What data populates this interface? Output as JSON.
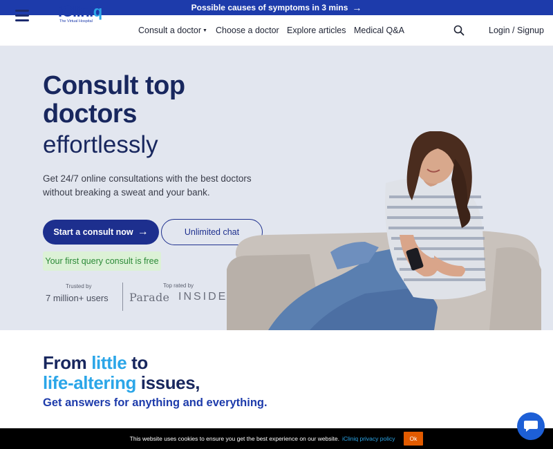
{
  "banner": {
    "text": "Possible causes of symptoms in 3 mins",
    "arrow": "→"
  },
  "nav": {
    "logo_text": "iClini",
    "logo_q": "q",
    "logo_tagline": "The Virtual Hospital",
    "items": [
      {
        "label": "Consult a doctor",
        "has_dropdown": true
      },
      {
        "label": "Choose a doctor"
      },
      {
        "label": "Explore articles"
      },
      {
        "label": "Medical Q&A"
      }
    ],
    "login": "Login / Signup"
  },
  "hero": {
    "title_line1": "Consult top",
    "title_line2": "doctors",
    "title_line3": "effortlessly",
    "subtitle": "Get 24/7 online consultations with the best doctors without breaking a sweat and your bank.",
    "primary_button": "Start a consult now",
    "primary_arrow": "→",
    "secondary_button": "Unlimited chat",
    "free_note": "Your first query consult is free",
    "trusted_label": "Trusted by",
    "trusted_value": "7 million+ users",
    "toprated_label": "Top rated by",
    "press": [
      "Parade",
      "INSIDER"
    ]
  },
  "section2": {
    "line1_a": "From ",
    "line1_hl": "little",
    "line1_b": " to",
    "line2_hl": "life-altering",
    "line2_b": " issues,",
    "subtitle": "Get answers for anything and everything."
  },
  "cookie": {
    "text": "This website uses cookies to ensure you get the best experience on our website.",
    "link": "iCliniq privacy policy",
    "ok": "Ok"
  },
  "colors": {
    "brand": "#1d3bab",
    "accent": "#2ba6e8",
    "navy": "#18275e",
    "hero_bg": "#e2e6ef",
    "cookie_ok": "#e25b00"
  }
}
